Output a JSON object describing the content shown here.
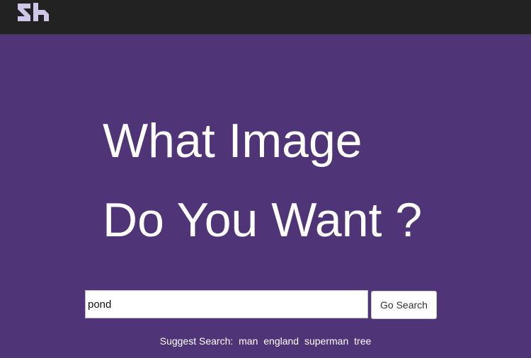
{
  "header": {
    "logo_icon": "sh-logo-icon",
    "logo_color": "#cfc6e8"
  },
  "hero": {
    "line1": "What Image",
    "line2": "Do You Want ?"
  },
  "search": {
    "value": "pond",
    "button_label": "Go Search"
  },
  "suggest": {
    "label": "Suggest Search:",
    "items": [
      "man",
      "england",
      "superman",
      "tree"
    ]
  },
  "colors": {
    "background": "#4f3578",
    "topbar": "#222222",
    "text": "#ffffff"
  }
}
